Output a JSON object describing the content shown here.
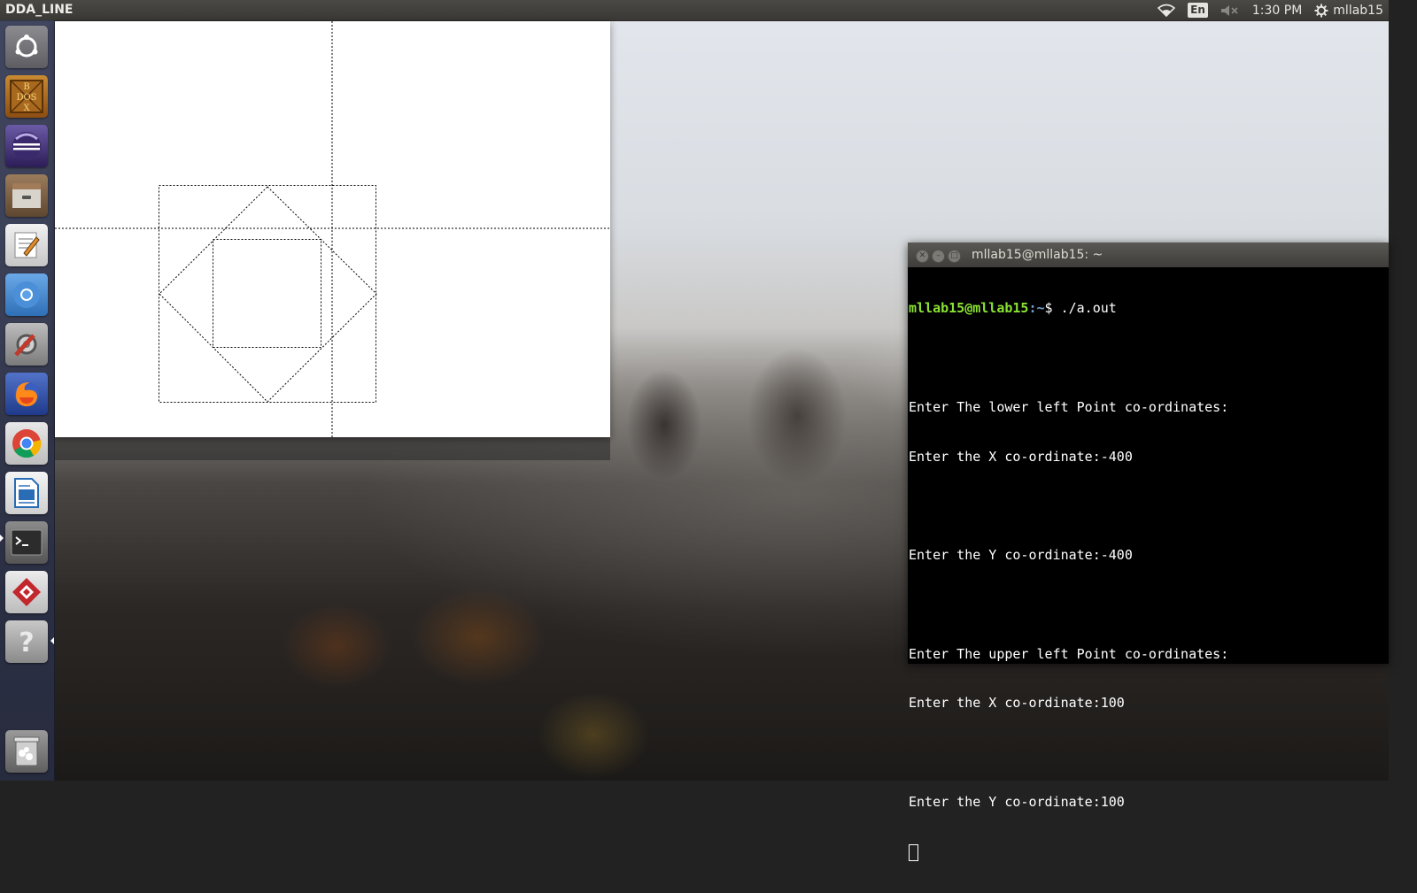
{
  "top_panel": {
    "app_title": "DDA_LINE",
    "lang": "En",
    "time": "1:30 PM",
    "user": "mllab15",
    "icons": [
      "wifi-icon",
      "keyboard-layout-icon",
      "volume-muted-icon",
      "system-settings-icon"
    ]
  },
  "launcher": {
    "items": [
      {
        "name": "ubuntu-dash-icon",
        "color": "#6f6f73"
      },
      {
        "name": "dosbox-icon",
        "color": "#b56a1a",
        "logo_letters": "BDOSX"
      },
      {
        "name": "eclipse-icon",
        "color": "#3b2a6b"
      },
      {
        "name": "files-icon",
        "color": "#8a6c4e"
      },
      {
        "name": "text-editor-icon",
        "color": "#d8d8d8"
      },
      {
        "name": "chromium-icon",
        "color": "#4a90d9"
      },
      {
        "name": "system-settings-icon",
        "color": "#9a9a9a"
      },
      {
        "name": "firefox-icon",
        "color": "#e66000"
      },
      {
        "name": "chrome-icon",
        "color": "#db4437"
      },
      {
        "name": "libreoffice-writer-icon",
        "color": "#2a6cb5"
      },
      {
        "name": "terminal-icon",
        "color": "#2c2c2c"
      },
      {
        "name": "app-red-icon",
        "color": "#c1272d"
      },
      {
        "name": "help-icon",
        "color": "#b0b0b0"
      },
      {
        "name": "trash-icon",
        "color": "#7a7a7a"
      }
    ]
  },
  "terminal": {
    "title": "mllab15@mllab15: ~",
    "prompt_user": "mllab15@mllab15",
    "prompt_path": ":~",
    "prompt_symbol": "$ ",
    "command": "./a.out",
    "output_lines": [
      "",
      "Enter The lower left Point co-ordinates:",
      "Enter the X co-ordinate:-400",
      "",
      "Enter the Y co-ordinate:-400",
      "",
      "Enter The upper left Point co-ordinates:",
      "Enter the X co-ordinate:100",
      "",
      "Enter the Y co-ordinate:100"
    ]
  },
  "graphics": {
    "line_style": "dashed",
    "stroke_color": "#000000",
    "background": "#ffffff"
  }
}
